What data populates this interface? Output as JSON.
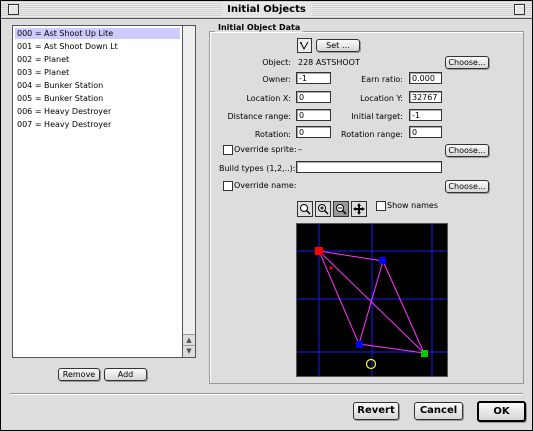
{
  "window": {
    "title": "Initial Objects"
  },
  "objects_list": {
    "items": [
      "000 = Ast Shoot Up Lite",
      "001 = Ast Shoot Down Lt",
      "002 = Planet",
      "003 = Planet",
      "004 = Bunker Station",
      "005 = Bunker Station",
      "006 = Heavy Destroyer",
      "007 = Heavy Destroyer"
    ],
    "selected_index": 0
  },
  "list_buttons": {
    "remove": "Remove",
    "add": "Add"
  },
  "panel": {
    "title": "Initial Object Data",
    "set_button": "Set",
    "object_label": "Object:",
    "object_value": "228 ASTSHOOT",
    "choose_label": "Choose...",
    "owner_label": "Owner:",
    "owner_value": "-1",
    "earn_ratio_label": "Earn ratio:",
    "earn_ratio_value": "0.000",
    "location_x_label": "Location X:",
    "location_x_value": "0",
    "location_y_label": "Location Y:",
    "location_y_value": "32767",
    "distance_range_label": "Distance range:",
    "distance_range_value": "0",
    "initial_target_label": "Initial target:",
    "initial_target_value": "-1",
    "rotation_label": "Rotation:",
    "rotation_value": "0",
    "rotation_range_label": "Rotation range:",
    "rotation_range_value": "0",
    "override_sprite_label": "Override sprite:",
    "override_sprite_value": "–",
    "build_types_label": "Build types (1,2,..):",
    "build_types_value": "",
    "override_name_label": "Override name:",
    "show_names_label": "Show names"
  },
  "footer": {
    "revert": "Revert",
    "cancel": "Cancel",
    "ok": "OK"
  },
  "map_colors": {
    "background": "#000000",
    "grid": "#1a1aff",
    "links": "#ff33ff",
    "red": "#ff0000",
    "blue": "#0000ff",
    "green": "#00cc00",
    "marker": "#ffff00"
  }
}
